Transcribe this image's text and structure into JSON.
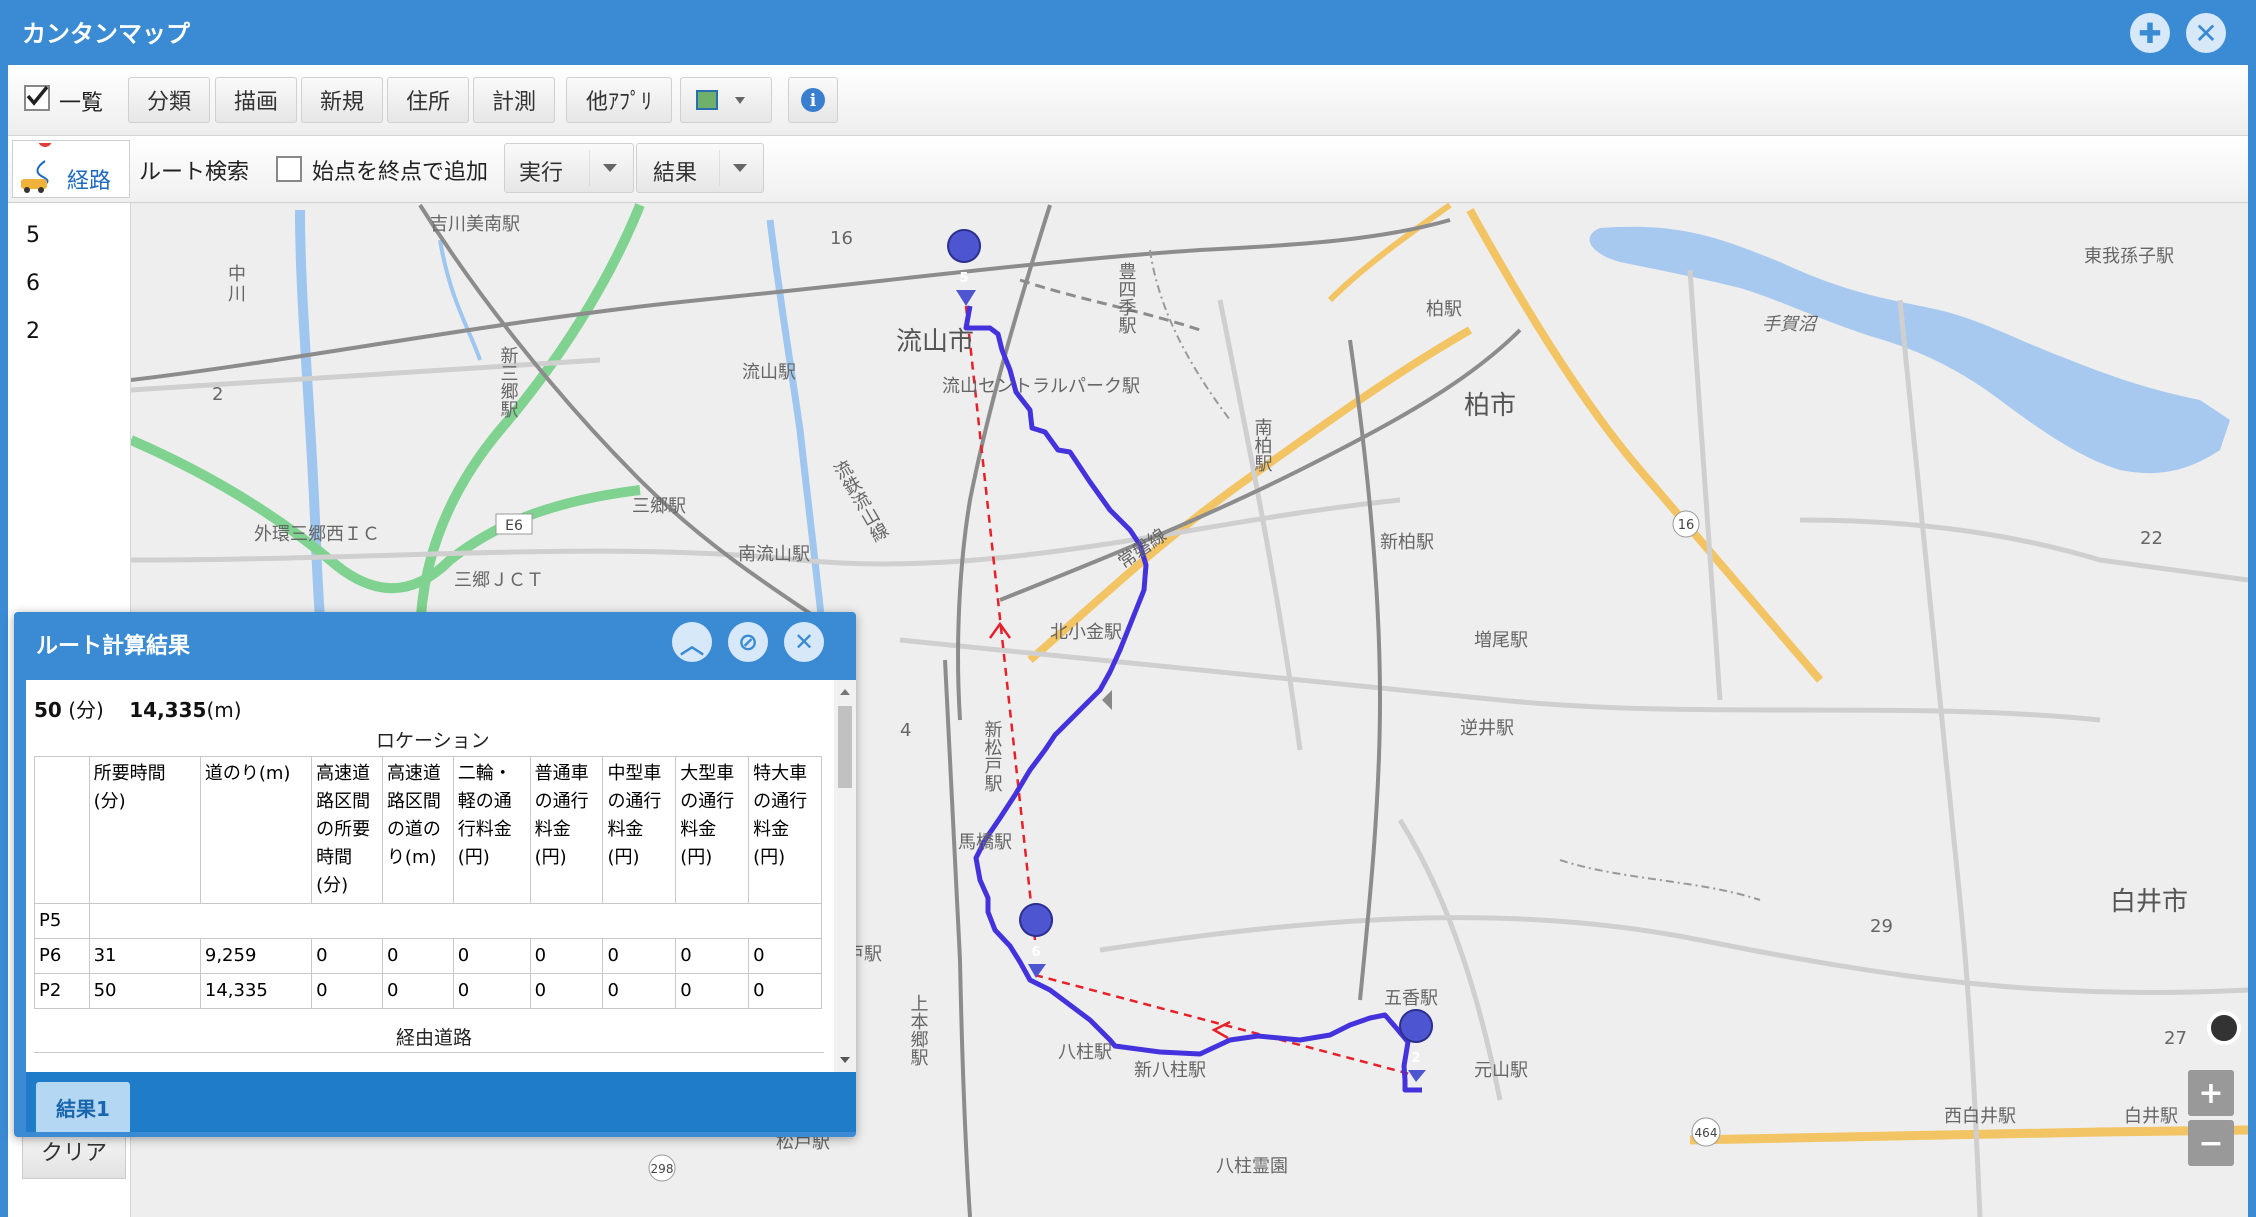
{
  "window": {
    "title": "カンタンマップ"
  },
  "toolbar": {
    "list_label": "一覧",
    "buttons": [
      "分類",
      "描画",
      "新規",
      "住所",
      "計測",
      "他ｱﾌﾟﾘ"
    ]
  },
  "route_bar": {
    "route_tab_label": "経路",
    "search_label": "ルート検索",
    "start_as_end_label": "始点を終点で追加",
    "run_label": "実行",
    "result_label": "結果"
  },
  "route_list": [
    "5",
    "6",
    "2"
  ],
  "map": {
    "labels": {
      "yoshikawa_minami": "吉川美南駅",
      "nagareyama_shi": "流山市",
      "nagareyama_eki": "流山駅",
      "central_park": "流山セントラルパーク駅",
      "toyoshiki": "豊四季駅",
      "kashiwa_eki": "柏駅",
      "kashiwa_shi": "柏市",
      "higashi_abiko": "東我孫子駅",
      "teganuma": "手賀沼",
      "shin_misato": "新三郷駅",
      "misato": "三郷駅",
      "minami_nagareyama": "南流山駅",
      "gaikan_misato_nishi": "外環三郷西ＩＣ",
      "misato_jct": "三郷ＪＣＴ",
      "minami_kashiwa": "南柏駅",
      "shin_kashiwa": "新柏駅",
      "kita_kogane": "北小金駅",
      "masuo": "増尾駅",
      "sakai": "逆井駅",
      "shin_matsudo": "新松戸駅",
      "mabashi": "馬橋駅",
      "shiroi_shi": "白井市",
      "goka": "五香駅",
      "motoyama": "元山駅",
      "yabashira": "八柱駅",
      "shin_yabashira": "新八柱駅",
      "yabashira_reien": "八柱霊園",
      "nishi_shiroi": "西白井駅",
      "shiroi": "白井駅",
      "kamihongo": "上本郷駅",
      "matsudo": "松戸駅",
      "ryutetsu": "流鉄流山線",
      "joban": "常磐線",
      "e6": "E6",
      "r16": "16",
      "r16b": "16",
      "r298": "298",
      "r464": "464",
      "h16": "16",
      "h4": "4",
      "h29": "29",
      "h22": "22",
      "h27": "27",
      "h2": "2",
      "partial_station": "戸駅",
      "naka": "中",
      "kawa": "川"
    },
    "pins": [
      "5",
      "6",
      "2"
    ],
    "colors": {
      "route": "#4433dd",
      "straight": "#e8202a",
      "rail": "#8a8a8a",
      "major_road": "#f2c463",
      "expressway": "#7fd28f",
      "water": "#9fc6ef"
    }
  },
  "result_dialog": {
    "title": "ルート計算結果",
    "summary_min": "50",
    "summary_min_unit": "(分)",
    "summary_dist": "14,335",
    "summary_dist_unit": "(m)",
    "location_caption": "ロケーション",
    "via_caption": "経由道路",
    "tab_label": "結果1",
    "headers": [
      "",
      "所要時間(分)",
      "道のり(m)",
      "高速道路区間の所要時間(分)",
      "高速道路区間の道のり(m)",
      "二輪・軽の通行料金(円)",
      "普通車の通行料金(円)",
      "中型車の通行料金(円)",
      "大型車の通行料金(円)",
      "特大車の通行料金(円)"
    ],
    "rows": [
      [
        "P5",
        "",
        "",
        "",
        "",
        "",
        "",
        "",
        "",
        ""
      ],
      [
        "P6",
        "31",
        "9,259",
        "0",
        "0",
        "0",
        "0",
        "0",
        "0",
        "0"
      ],
      [
        "P2",
        "50",
        "14,335",
        "0",
        "0",
        "0",
        "0",
        "0",
        "0",
        "0"
      ]
    ]
  },
  "clear_label": "クリア",
  "zoom": {
    "in": "+",
    "out": "−"
  }
}
